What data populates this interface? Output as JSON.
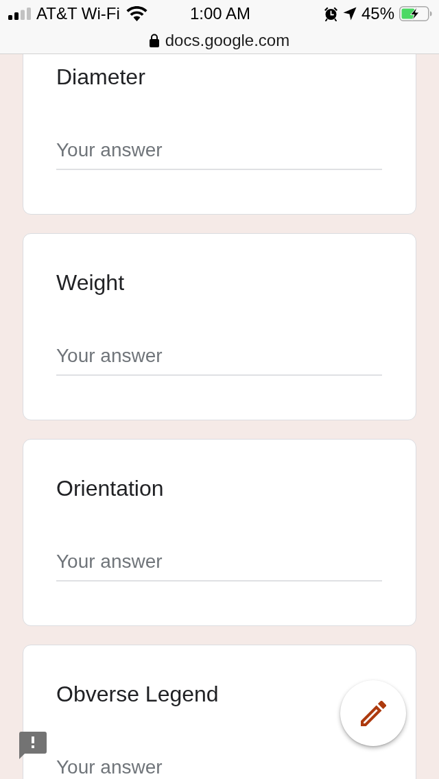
{
  "status_bar": {
    "carrier": "AT&T Wi-Fi",
    "time": "1:00 AM",
    "battery": "45%"
  },
  "address_bar": {
    "url": "docs.google.com"
  },
  "questions": [
    {
      "title": "Diameter",
      "placeholder": "Your answer"
    },
    {
      "title": "Weight",
      "placeholder": "Your answer"
    },
    {
      "title": "Orientation",
      "placeholder": "Your answer"
    },
    {
      "title": "Obverse Legend",
      "placeholder": "Your answer"
    }
  ]
}
